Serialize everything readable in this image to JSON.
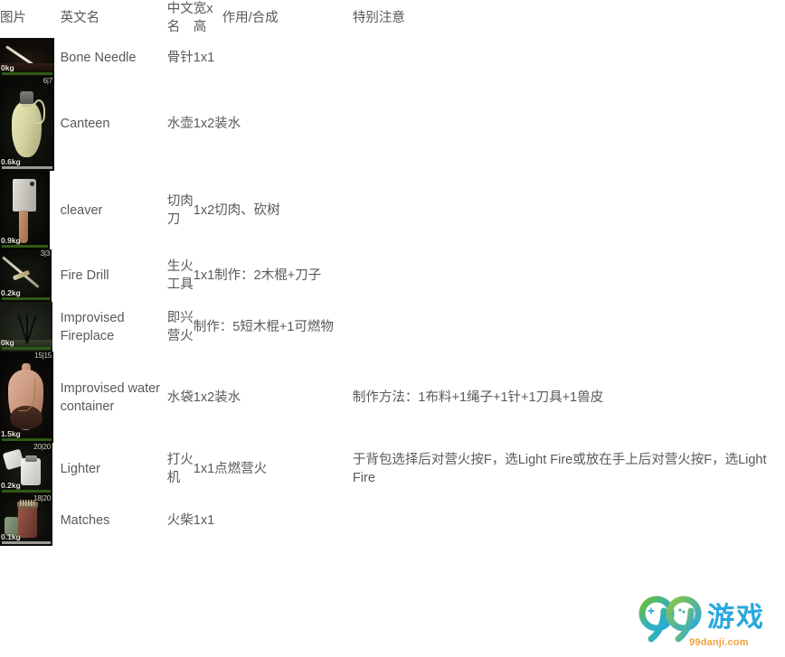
{
  "table": {
    "headers": {
      "image": "图片",
      "english_name": "英文名",
      "chinese_name": "中文名",
      "size": "宽x高",
      "use_craft": "作用/合成",
      "notes": "特别注意"
    },
    "rows": [
      {
        "icon": {
          "art": "bone-needle",
          "badge": "",
          "weight": "0kg",
          "bar": "green",
          "width": 60,
          "height": 43
        },
        "english_name": "Bone Needle",
        "chinese_name": "骨针",
        "size_use": "1x1",
        "notes": ""
      },
      {
        "icon": {
          "art": "canteen",
          "badge": "6|7",
          "weight": "0.6kg",
          "bar": "gray",
          "width": 60,
          "height": 104
        },
        "english_name": "Canteen",
        "chinese_name": "水壶",
        "size_use": "1x2装水",
        "notes": ""
      },
      {
        "icon": {
          "art": "cleaver",
          "badge": "",
          "weight": "0.9kg",
          "bar": "green",
          "width": 55,
          "height": 87
        },
        "english_name": "cleaver",
        "chinese_name": "切肉刀",
        "size_use": "1x2切肉、砍树",
        "notes": ""
      },
      {
        "icon": {
          "art": "fire-drill",
          "badge": "3|3",
          "weight": "0.2kg",
          "bar": "green",
          "width": 57,
          "height": 58
        },
        "english_name": "Fire Drill",
        "chinese_name": "生火工具",
        "size_use": "1x1制作：2木棍+刀子",
        "notes": ""
      },
      {
        "icon": {
          "art": "fireplace",
          "badge": "",
          "weight": "0kg",
          "bar": "green",
          "width": 58,
          "height": 55
        },
        "english_name": "Improvised Fireplace",
        "chinese_name": "即兴营火",
        "size_use": "制作：5短木棍+1可燃物",
        "notes": ""
      },
      {
        "icon": {
          "art": "water-container",
          "badge": "15|15",
          "weight": "1.5kg",
          "bar": "green",
          "width": 59,
          "height": 101
        },
        "english_name": "Improvised water container",
        "chinese_name": "水袋",
        "size_use": "1x2装水",
        "notes": "制作方法：1布料+1绳子+1针+1刀具+1兽皮"
      },
      {
        "icon": {
          "art": "lighter",
          "badge": "20|20",
          "weight": "0.2kg",
          "bar": "green",
          "width": 58,
          "height": 57
        },
        "english_name": "Lighter",
        "chinese_name": "打火机",
        "size_use": "1x1点燃营火",
        "notes": "于背包选择后对营火按F，选Light Fire或放在手上后对营火按F，选Light Fire"
      },
      {
        "icon": {
          "art": "matches",
          "badge": "18|20",
          "weight": "0.1kg",
          "bar": "gray",
          "width": 58,
          "height": 57
        },
        "english_name": "Matches",
        "chinese_name": "火柴",
        "size_use": "1x1",
        "notes": ""
      }
    ]
  },
  "watermark": {
    "brand": "99游戏",
    "domain": "99danji.com",
    "color_green": "#5cb531",
    "color_blue": "#2aa8e0",
    "color_orange": "#f0a23c"
  }
}
